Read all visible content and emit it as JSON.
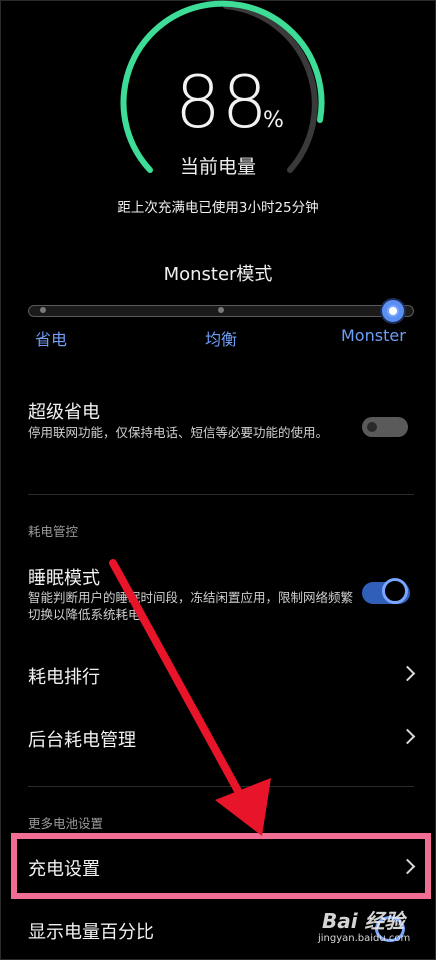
{
  "battery": {
    "percent_number": "88",
    "percent_sign": "%",
    "percent_level": 0.88,
    "label": "当前电量",
    "usage_since_full": "距上次充满电已使用3小时25分钟",
    "arc_color": "#3ddc97"
  },
  "power_mode": {
    "title": "Monster模式",
    "options": [
      "省电",
      "均衡",
      "Monster"
    ],
    "selected_index": 2,
    "accent_color": "#6f9ef5"
  },
  "super_save": {
    "title": "超级省电",
    "description": "停用联网功能，仅保持电话、短信等必要功能的使用。",
    "enabled": false
  },
  "power_control": {
    "section_label": "耗电管控",
    "sleep_mode": {
      "title": "睡眠模式",
      "description": "智能判断用户的睡眠时间段，冻结闲置应用，限制网络频繁切换以降低系统耗电。",
      "enabled": true
    },
    "ranking_label": "耗电排行",
    "background_label": "后台耗电管理"
  },
  "more_settings": {
    "section_label": "更多电池设置",
    "charging_label": "充电设置",
    "show_percent_label": "显示电量百分比"
  },
  "watermark": {
    "brand": "Bai 经验",
    "site": "jingyan.baidu.com"
  },
  "annotation": {
    "highlight_color": "#f26d94",
    "arrow_color": "#e8142a",
    "arrow_icon": "red-arrow-icon"
  }
}
